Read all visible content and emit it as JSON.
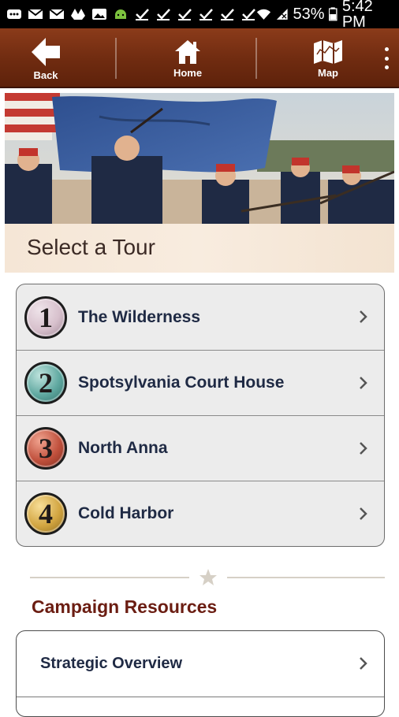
{
  "status_bar": {
    "battery": "53%",
    "time": "5:42 PM",
    "icons": [
      "messages-icon",
      "gmail-icon",
      "gmail-icon",
      "drive-icon",
      "image-icon",
      "android-icon",
      "check-icon",
      "check-icon",
      "check-icon",
      "check-icon",
      "check-icon",
      "check-icon",
      "wifi-icon",
      "signal-icon",
      "battery-icon"
    ]
  },
  "navbar": {
    "back_label": "Back",
    "home_label": "Home",
    "map_label": "Map",
    "colors": {
      "bar": "#6f2b10",
      "text": "#ffffff"
    }
  },
  "hero": {
    "image": "civil-war-battle-painting"
  },
  "page": {
    "title": "Select a Tour"
  },
  "tours": [
    {
      "number": "1",
      "label": "The Wilderness",
      "badge_color": "#d7c0cc"
    },
    {
      "number": "2",
      "label": "Spotsylvania Court House",
      "badge_color": "#5fa8a0"
    },
    {
      "number": "3",
      "label": "North Anna",
      "badge_color": "#c0503c"
    },
    {
      "number": "4",
      "label": "Cold Harbor",
      "badge_color": "#d2a541"
    }
  ],
  "resources": {
    "title": "Campaign Resources",
    "items": [
      {
        "label": "Strategic Overview"
      }
    ]
  }
}
